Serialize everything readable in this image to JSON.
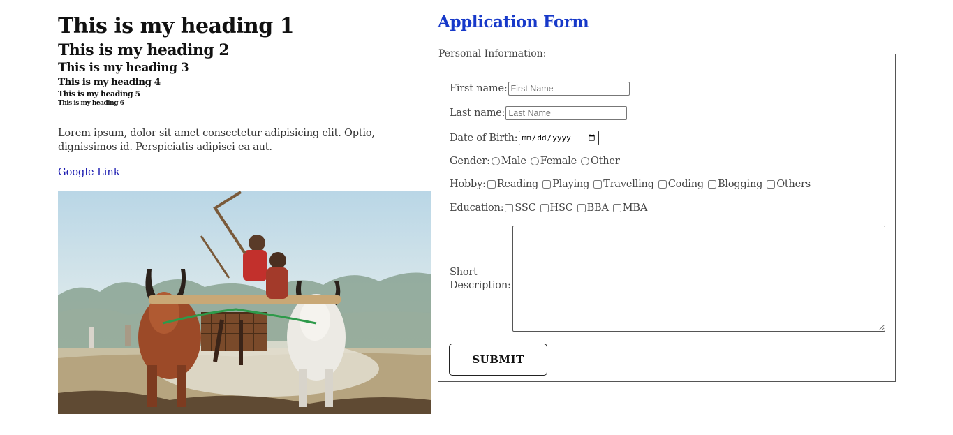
{
  "headings": {
    "h1": "This is my heading 1",
    "h2": "This is my heading 2",
    "h3": "This is my heading 3",
    "h4": "This is my heading 4",
    "h5": "This is my heading 5",
    "h6": "This is my heading 6"
  },
  "paragraph": "Lorem ipsum, dolor sit amet consectetur adipisicing elit. Optio, dignissimos id. Perspiciatis adipisci ea aut.",
  "link_text": "Google Link",
  "form": {
    "title": "Application Form",
    "legend": "Personal Information:",
    "first_name_label": "First name:",
    "first_name_placeholder": "First Name",
    "last_name_label": "Last name:",
    "last_name_placeholder": "Last Name",
    "dob_label": "Date of Birth:",
    "gender_label": "Gender:",
    "gender_options": [
      "Male",
      "Female",
      "Other"
    ],
    "hobby_label": "Hobby:",
    "hobby_options": [
      "Reading",
      "Playing",
      "Travelling",
      "Coding",
      "Blogging",
      "Others"
    ],
    "education_label": "Education:",
    "education_options": [
      "SSC",
      "HSC",
      "BBA",
      "MBA"
    ],
    "short_description_label_1": "Short",
    "short_description_label_2": "Description:",
    "submit_label": "SUBMIT"
  },
  "colors": {
    "form_title": "#1739c9",
    "link": "#1a1ab0"
  }
}
